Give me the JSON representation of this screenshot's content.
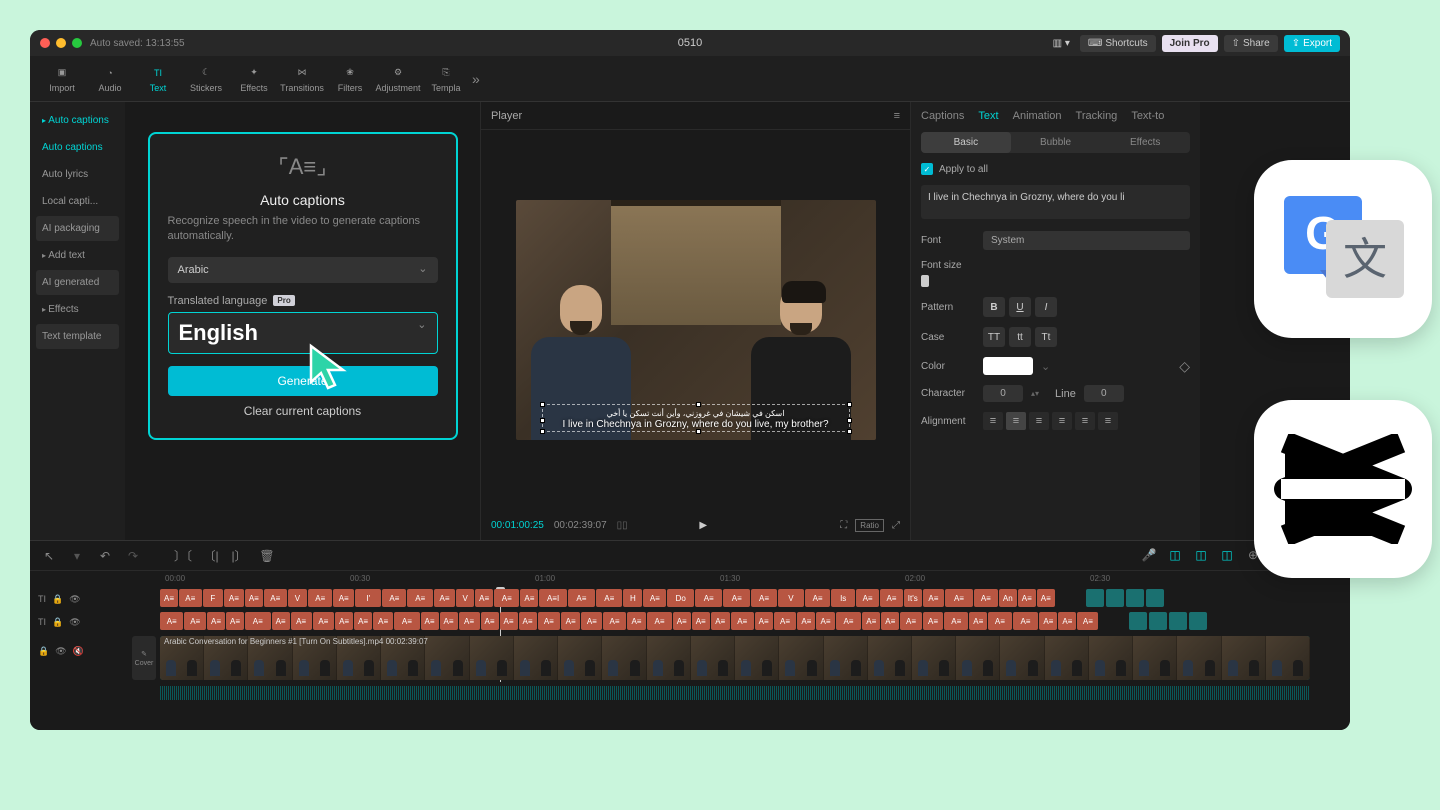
{
  "titlebar": {
    "autosave": "Auto saved: 13:13:55",
    "title": "0510",
    "shortcuts": "Shortcuts",
    "joinpro": "Join Pro",
    "share": "Share",
    "export": "Export"
  },
  "toolbar": {
    "items": [
      "Import",
      "Audio",
      "Text",
      "Stickers",
      "Effects",
      "Transitions",
      "Filters",
      "Adjustment",
      "Templa"
    ],
    "active_index": 2
  },
  "sidebar": {
    "items": [
      {
        "label": "Auto captions",
        "type": "header",
        "active": true
      },
      {
        "label": "Auto captions",
        "type": "item",
        "active": true
      },
      {
        "label": "Auto lyrics",
        "type": "item"
      },
      {
        "label": "Local capti...",
        "type": "item"
      },
      {
        "label": "AI packaging",
        "type": "item",
        "bg": true
      },
      {
        "label": "Add text",
        "type": "sub"
      },
      {
        "label": "AI generated",
        "type": "item",
        "bg": true
      },
      {
        "label": "Effects",
        "type": "sub"
      },
      {
        "label": "Text template",
        "type": "item",
        "bg": true
      }
    ]
  },
  "autocap": {
    "title": "Auto captions",
    "desc": "Recognize speech in the video to generate captions automatically.",
    "lang1": "Arabic",
    "trans_label": "Translated language",
    "pro": "Pro",
    "lang2": "English",
    "generate": "Generate",
    "clear": "Clear current captions"
  },
  "player": {
    "label": "Player",
    "caption_ar": "اسكن في شيشان في غروزني، وأين أنت تسكن يا أخي",
    "caption_en": "I live in Chechnya in Grozny, where do you live, my brother?",
    "tc_current": "00:01:00:25",
    "tc_total": "00:02:39:07",
    "ratio": "Ratio"
  },
  "props": {
    "tabs": [
      "Captions",
      "Text",
      "Animation",
      "Tracking",
      "Text-to"
    ],
    "tab_active": 1,
    "subtabs": [
      "Basic",
      "Bubble",
      "Effects"
    ],
    "subtab_active": 0,
    "apply": "Apply to all",
    "text_value": "I live in Chechnya in Grozny, where do you li",
    "font_label": "Font",
    "font_value": "System",
    "fontsize_label": "Font size",
    "pattern_label": "Pattern",
    "pattern_btns": [
      "B",
      "U",
      "I"
    ],
    "case_label": "Case",
    "case_btns": [
      "TT",
      "tt",
      "Tt"
    ],
    "color_label": "Color",
    "char_label": "Character",
    "char_val": "0",
    "line_label": "Line",
    "line_val": "0",
    "align_label": "Alignment"
  },
  "timeline": {
    "ticks": [
      "00:00",
      "00:30",
      "01:00",
      "01:30",
      "02:00",
      "02:30"
    ],
    "clip_label": "Arabic Conversation for Beginners #1 [Turn On Subtitles].mp4   00:02:39:07",
    "cover": "Cover"
  }
}
